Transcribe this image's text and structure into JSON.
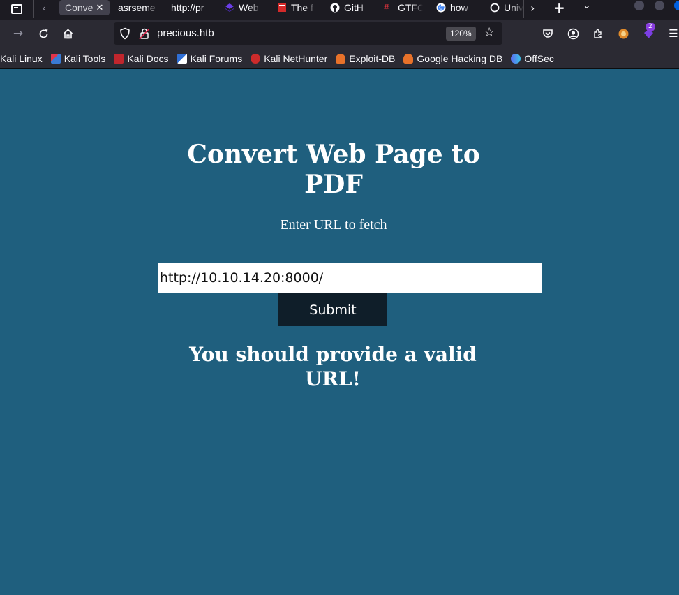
{
  "browser": {
    "tabs": [
      {
        "label": "Conve",
        "active": true,
        "icon": "none"
      },
      {
        "label": "asrseme",
        "active": false,
        "icon": "none"
      },
      {
        "label": "http://pr",
        "active": false,
        "icon": "none"
      },
      {
        "label": "Web",
        "active": false,
        "icon": "stack-icon"
      },
      {
        "label": "The f",
        "active": false,
        "icon": "book-icon"
      },
      {
        "label": "GitH",
        "active": false,
        "icon": "github-icon"
      },
      {
        "label": "GTFO",
        "active": false,
        "icon": "hash-icon"
      },
      {
        "label": "how",
        "active": false,
        "icon": "google-icon"
      },
      {
        "label": "Univ",
        "active": false,
        "icon": "circle-icon"
      }
    ],
    "url": "precious.htb",
    "zoom": "120%",
    "extension_badge": "2",
    "bookmarks": [
      {
        "label": "Kali Linux",
        "icon": "none",
        "color": "#2b2a33"
      },
      {
        "label": "Kali Tools",
        "icon": "kali-tools-icon",
        "color": "#3a7bd5"
      },
      {
        "label": "Kali Docs",
        "icon": "kali-docs-icon",
        "color": "#c0262d"
      },
      {
        "label": "Kali Forums",
        "icon": "kali-forums-icon",
        "color": "#2f6fd6"
      },
      {
        "label": "Kali NetHunter",
        "icon": "kali-nethunter-icon",
        "color": "#cc2b2b"
      },
      {
        "label": "Exploit-DB",
        "icon": "exploit-db-icon",
        "color": "#e8722a"
      },
      {
        "label": "Google Hacking DB",
        "icon": "ghdb-icon",
        "color": "#e8722a"
      },
      {
        "label": "OffSec",
        "icon": "offsec-icon",
        "color": "#5d6cf0"
      }
    ]
  },
  "page": {
    "title": "Convert Web Page to PDF",
    "subtitle": "Enter URL to fetch",
    "url_input_value": "http://10.10.14.20:8000/",
    "submit_label": "Submit",
    "error_message": "You should provide a valid URL!",
    "background_color": "#1f5f7e"
  }
}
